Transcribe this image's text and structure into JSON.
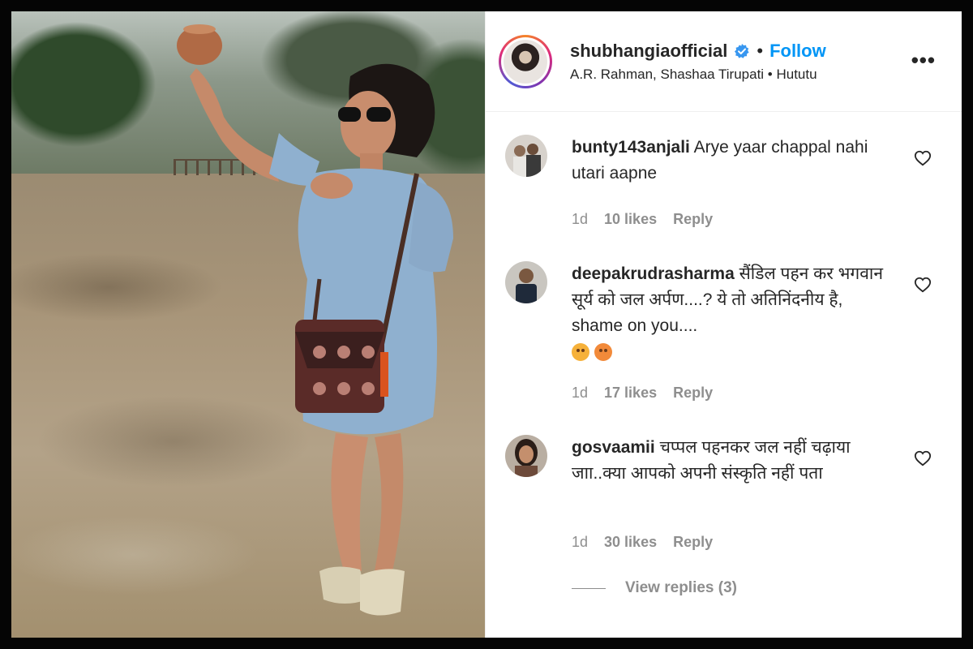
{
  "post": {
    "username": "shubhangiaofficial",
    "follow_label": "Follow",
    "separator": "•",
    "audio_line": "A.R. Rahman, Shashaa Tirupati • Hututu",
    "more_label": "•••"
  },
  "comments": [
    {
      "username": "bunty143anjali",
      "text": "Arye yaar chappal nahi utari aapne",
      "time": "1d",
      "likes": "10 likes",
      "reply": "Reply"
    },
    {
      "username": "deepakrudrasharma",
      "text": "सैंडिल पहन कर भगवान सूर्य को जल अर्पण....? ये तो अतिनिंदनीय है, shame on you....",
      "emoji": [
        "flushed-face",
        "angry-face"
      ],
      "time": "1d",
      "likes": "17 likes",
      "reply": "Reply"
    },
    {
      "username": "gosvaamii",
      "text": "चप्पल पहनकर जल नहीं चढ़ाया जाा..क्या आपको अपनी संस्कृति नहीं पता",
      "time": "1d",
      "likes": "30 likes",
      "reply": "Reply"
    }
  ],
  "view_replies": "View replies (3)",
  "colors": {
    "accent": "#0095f6",
    "muted": "#8e8e8e",
    "text": "#262626",
    "frame": "#050505"
  }
}
